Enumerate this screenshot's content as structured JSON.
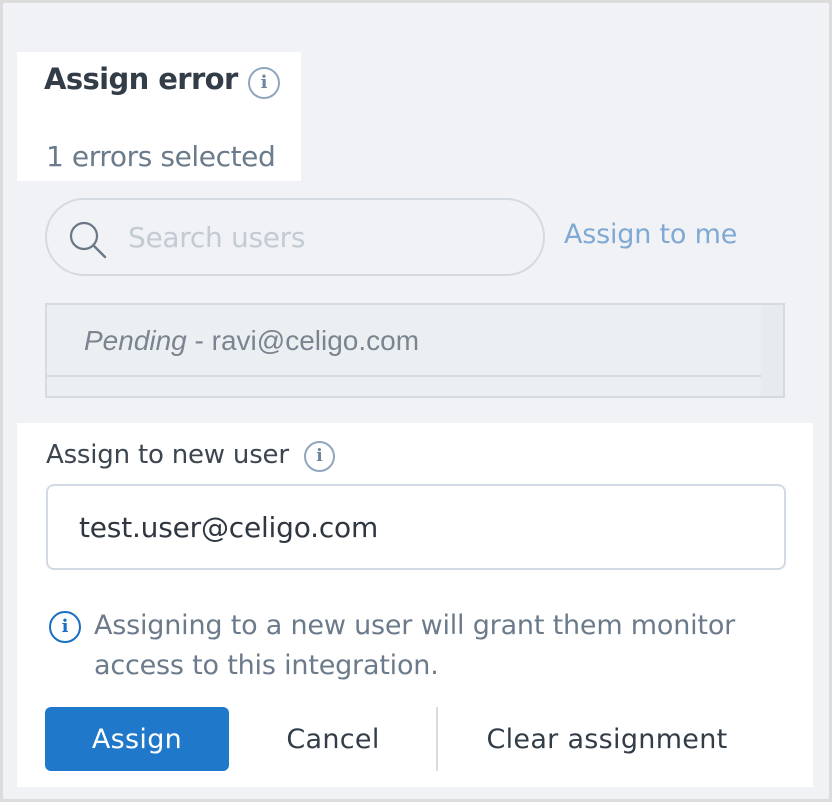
{
  "header": {
    "title": "Assign error",
    "info_icon": "i",
    "subtitle": "1 errors selected"
  },
  "search": {
    "placeholder": "Search users",
    "assign_to_me": "Assign to me"
  },
  "user_list": {
    "items": [
      {
        "status": "Pending",
        "separator": " - ",
        "email": "ravi@celigo.com"
      }
    ]
  },
  "new_user": {
    "label": "Assign to new user",
    "info_icon": "i",
    "value": "test.user@celigo.com"
  },
  "note": {
    "info_icon": "i",
    "text": "Assigning to a new user will grant them monitor access to this integration."
  },
  "actions": {
    "assign": "Assign",
    "cancel": "Cancel",
    "clear": "Clear assignment"
  },
  "colors": {
    "primary": "#1f78c9",
    "link": "#7fa9d4",
    "panel_background": "#f0f2f5"
  }
}
